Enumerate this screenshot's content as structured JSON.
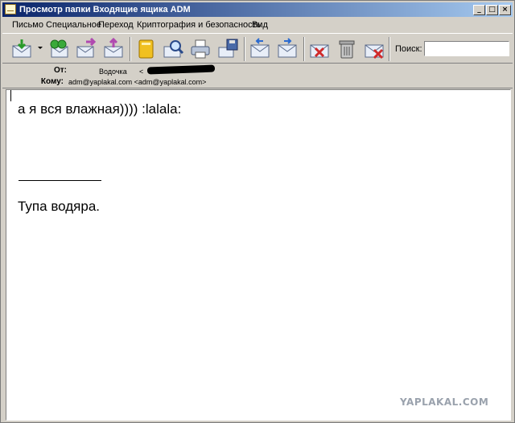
{
  "window": {
    "title": "Просмотр папки Входящие ящика ADM",
    "controls": [
      "_",
      "□",
      "×"
    ]
  },
  "menu": [
    "Письмо",
    "Специальное",
    "Переход",
    "Криптография и безопасность",
    "Вид"
  ],
  "toolbar": {
    "tools": [
      {
        "name": "get-mail-icon"
      },
      {
        "name": "reply-all-icon"
      },
      {
        "name": "forward-icon"
      },
      {
        "name": "new-mail-icon"
      },
      {
        "name": "address-book-icon"
      },
      {
        "name": "find-icon"
      },
      {
        "name": "print-icon"
      },
      {
        "name": "save-icon"
      },
      {
        "name": "prev-message-icon"
      },
      {
        "name": "next-message-icon"
      },
      {
        "name": "mark-spam-icon"
      },
      {
        "name": "trash-icon"
      },
      {
        "name": "delete-message-icon"
      }
    ],
    "search_label": "Поиск:",
    "search_value": ""
  },
  "header": {
    "from_label": "От:",
    "from_name": "Водочка",
    "from_prefix": "<",
    "to_label": "Кому:",
    "to_value": "adm@yaplakal.com <adm@yaplakal.com>"
  },
  "message": {
    "line1": "а я вся влажная)))) :lalala:",
    "line2": "Тупа водяра."
  },
  "watermark": "YAPLAKAL.COM",
  "colors": {
    "titlebar_start": "#0a246a",
    "titlebar_end": "#a6caf0",
    "chrome": "#d4d0c8",
    "watermark": "#9aa2ad"
  }
}
